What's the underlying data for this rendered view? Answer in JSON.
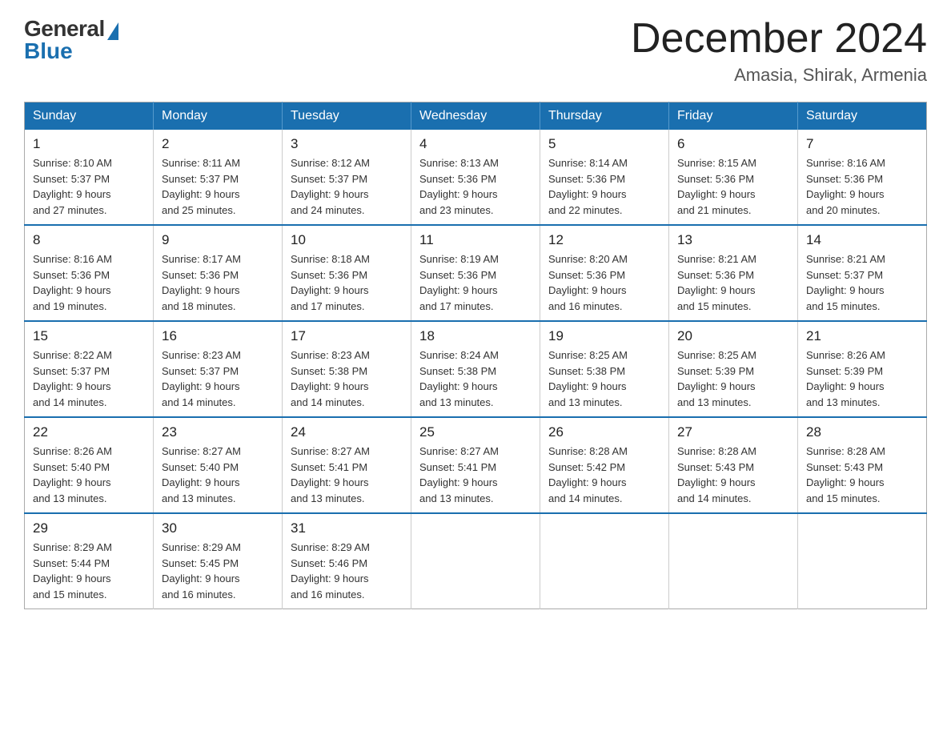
{
  "logo": {
    "general": "General",
    "blue": "Blue"
  },
  "title": "December 2024",
  "location": "Amasia, Shirak, Armenia",
  "weekdays": [
    "Sunday",
    "Monday",
    "Tuesday",
    "Wednesday",
    "Thursday",
    "Friday",
    "Saturday"
  ],
  "weeks": [
    [
      {
        "day": "1",
        "sunrise": "8:10 AM",
        "sunset": "5:37 PM",
        "daylight": "9 hours and 27 minutes."
      },
      {
        "day": "2",
        "sunrise": "8:11 AM",
        "sunset": "5:37 PM",
        "daylight": "9 hours and 25 minutes."
      },
      {
        "day": "3",
        "sunrise": "8:12 AM",
        "sunset": "5:37 PM",
        "daylight": "9 hours and 24 minutes."
      },
      {
        "day": "4",
        "sunrise": "8:13 AM",
        "sunset": "5:36 PM",
        "daylight": "9 hours and 23 minutes."
      },
      {
        "day": "5",
        "sunrise": "8:14 AM",
        "sunset": "5:36 PM",
        "daylight": "9 hours and 22 minutes."
      },
      {
        "day": "6",
        "sunrise": "8:15 AM",
        "sunset": "5:36 PM",
        "daylight": "9 hours and 21 minutes."
      },
      {
        "day": "7",
        "sunrise": "8:16 AM",
        "sunset": "5:36 PM",
        "daylight": "9 hours and 20 minutes."
      }
    ],
    [
      {
        "day": "8",
        "sunrise": "8:16 AM",
        "sunset": "5:36 PM",
        "daylight": "9 hours and 19 minutes."
      },
      {
        "day": "9",
        "sunrise": "8:17 AM",
        "sunset": "5:36 PM",
        "daylight": "9 hours and 18 minutes."
      },
      {
        "day": "10",
        "sunrise": "8:18 AM",
        "sunset": "5:36 PM",
        "daylight": "9 hours and 17 minutes."
      },
      {
        "day": "11",
        "sunrise": "8:19 AM",
        "sunset": "5:36 PM",
        "daylight": "9 hours and 17 minutes."
      },
      {
        "day": "12",
        "sunrise": "8:20 AM",
        "sunset": "5:36 PM",
        "daylight": "9 hours and 16 minutes."
      },
      {
        "day": "13",
        "sunrise": "8:21 AM",
        "sunset": "5:36 PM",
        "daylight": "9 hours and 15 minutes."
      },
      {
        "day": "14",
        "sunrise": "8:21 AM",
        "sunset": "5:37 PM",
        "daylight": "9 hours and 15 minutes."
      }
    ],
    [
      {
        "day": "15",
        "sunrise": "8:22 AM",
        "sunset": "5:37 PM",
        "daylight": "9 hours and 14 minutes."
      },
      {
        "day": "16",
        "sunrise": "8:23 AM",
        "sunset": "5:37 PM",
        "daylight": "9 hours and 14 minutes."
      },
      {
        "day": "17",
        "sunrise": "8:23 AM",
        "sunset": "5:38 PM",
        "daylight": "9 hours and 14 minutes."
      },
      {
        "day": "18",
        "sunrise": "8:24 AM",
        "sunset": "5:38 PM",
        "daylight": "9 hours and 13 minutes."
      },
      {
        "day": "19",
        "sunrise": "8:25 AM",
        "sunset": "5:38 PM",
        "daylight": "9 hours and 13 minutes."
      },
      {
        "day": "20",
        "sunrise": "8:25 AM",
        "sunset": "5:39 PM",
        "daylight": "9 hours and 13 minutes."
      },
      {
        "day": "21",
        "sunrise": "8:26 AM",
        "sunset": "5:39 PM",
        "daylight": "9 hours and 13 minutes."
      }
    ],
    [
      {
        "day": "22",
        "sunrise": "8:26 AM",
        "sunset": "5:40 PM",
        "daylight": "9 hours and 13 minutes."
      },
      {
        "day": "23",
        "sunrise": "8:27 AM",
        "sunset": "5:40 PM",
        "daylight": "9 hours and 13 minutes."
      },
      {
        "day": "24",
        "sunrise": "8:27 AM",
        "sunset": "5:41 PM",
        "daylight": "9 hours and 13 minutes."
      },
      {
        "day": "25",
        "sunrise": "8:27 AM",
        "sunset": "5:41 PM",
        "daylight": "9 hours and 13 minutes."
      },
      {
        "day": "26",
        "sunrise": "8:28 AM",
        "sunset": "5:42 PM",
        "daylight": "9 hours and 14 minutes."
      },
      {
        "day": "27",
        "sunrise": "8:28 AM",
        "sunset": "5:43 PM",
        "daylight": "9 hours and 14 minutes."
      },
      {
        "day": "28",
        "sunrise": "8:28 AM",
        "sunset": "5:43 PM",
        "daylight": "9 hours and 15 minutes."
      }
    ],
    [
      {
        "day": "29",
        "sunrise": "8:29 AM",
        "sunset": "5:44 PM",
        "daylight": "9 hours and 15 minutes."
      },
      {
        "day": "30",
        "sunrise": "8:29 AM",
        "sunset": "5:45 PM",
        "daylight": "9 hours and 16 minutes."
      },
      {
        "day": "31",
        "sunrise": "8:29 AM",
        "sunset": "5:46 PM",
        "daylight": "9 hours and 16 minutes."
      },
      null,
      null,
      null,
      null
    ]
  ]
}
